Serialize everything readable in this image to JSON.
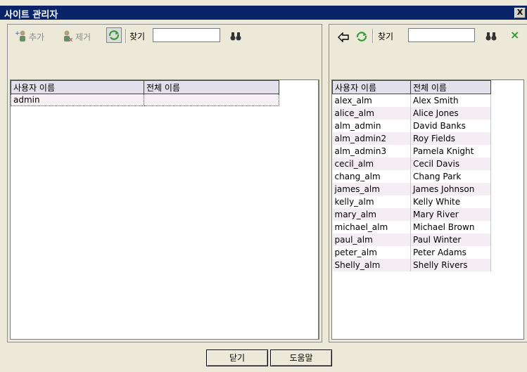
{
  "window": {
    "title": "사이트 관리자",
    "close_label": "X"
  },
  "left_panel": {
    "toolbar": {
      "add_label": "추가",
      "remove_label": "제거",
      "find_label": "찾기",
      "find_value": ""
    },
    "columns": [
      "사용자 이름",
      "전체 이름"
    ],
    "rows": [
      {
        "username": "admin",
        "fullname": ""
      }
    ]
  },
  "right_panel": {
    "toolbar": {
      "find_label": "찾기",
      "find_value": "",
      "close_label": "×"
    },
    "columns": [
      "사용자 이름",
      "전체 이름"
    ],
    "rows": [
      {
        "username": "alex_alm",
        "fullname": "Alex Smith"
      },
      {
        "username": "alice_alm",
        "fullname": "Alice Jones"
      },
      {
        "username": "alm_admin",
        "fullname": "David Banks"
      },
      {
        "username": "alm_admin2",
        "fullname": "Roy Fields"
      },
      {
        "username": "alm_admin3",
        "fullname": "Pamela Knight"
      },
      {
        "username": "cecil_alm",
        "fullname": "Cecil Davis"
      },
      {
        "username": "chang_alm",
        "fullname": "Chang Park"
      },
      {
        "username": "james_alm",
        "fullname": "James Johnson"
      },
      {
        "username": "kelly_alm",
        "fullname": "Kelly White"
      },
      {
        "username": "mary_alm",
        "fullname": "Mary River"
      },
      {
        "username": "michael_alm",
        "fullname": "Michael Brown"
      },
      {
        "username": "paul_alm",
        "fullname": "Paul Winter"
      },
      {
        "username": "peter_alm",
        "fullname": "Peter Adams"
      },
      {
        "username": "Shelly_alm",
        "fullname": "Shelly Rivers"
      }
    ]
  },
  "buttons": {
    "close_label": "닫기",
    "help_label": "도움말"
  },
  "colors": {
    "titlebar": "#0a246a",
    "dialog_bg": "#ece9d8",
    "row_alt": "#f4eef4"
  }
}
